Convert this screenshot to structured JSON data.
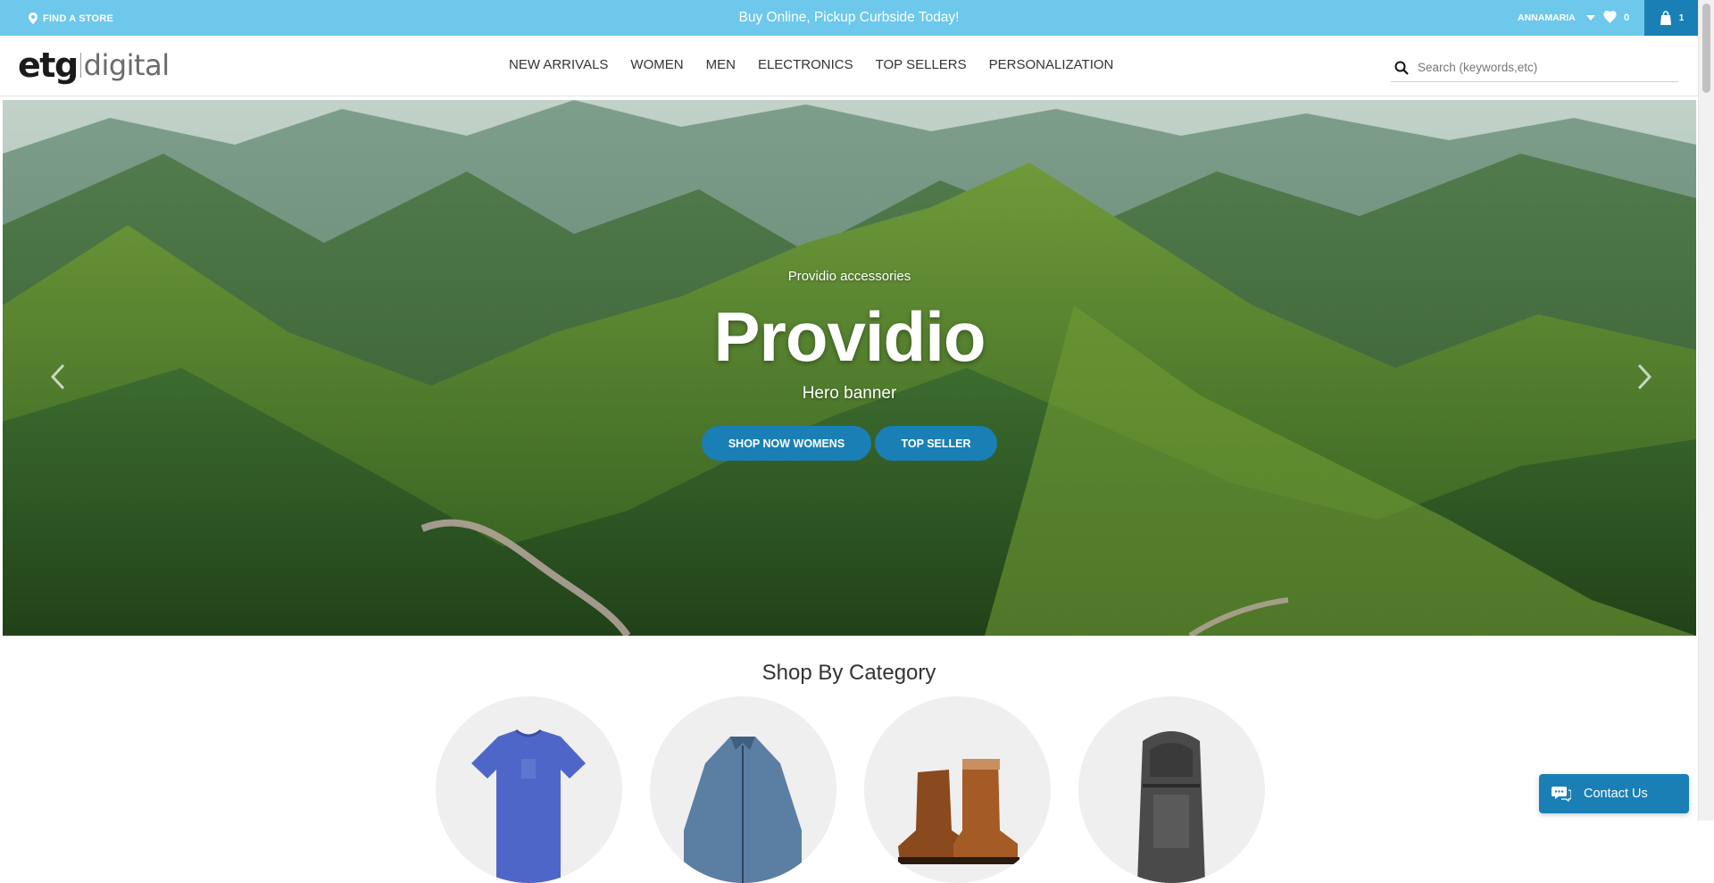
{
  "topbar": {
    "find_store": "FIND A STORE",
    "promo": "Buy Online, Pickup Curbside Today!",
    "account": "ANNAMARIA",
    "wishlist_count": "0",
    "cart_count": "1"
  },
  "header": {
    "logo_main": "etg",
    "logo_sub": "digital",
    "nav": [
      "NEW ARRIVALS",
      "WOMEN",
      "MEN",
      "ELECTRONICS",
      "TOP SELLERS",
      "PERSONALIZATION"
    ],
    "search_placeholder": "Search (keywords,etc)"
  },
  "hero": {
    "kicker": "Providio accessories",
    "title": "Providio",
    "subtitle": "Hero banner",
    "buttons": [
      "SHOP NOW WOMENS",
      "TOP SELLER"
    ]
  },
  "categories": {
    "title": "Shop By Category",
    "items": [
      "t-shirt",
      "jacket",
      "boots",
      "backpack"
    ]
  },
  "chat": {
    "label": "Contact Us"
  },
  "colors": {
    "topbar": "#6dc8ec",
    "accent": "#1a7fb5"
  }
}
